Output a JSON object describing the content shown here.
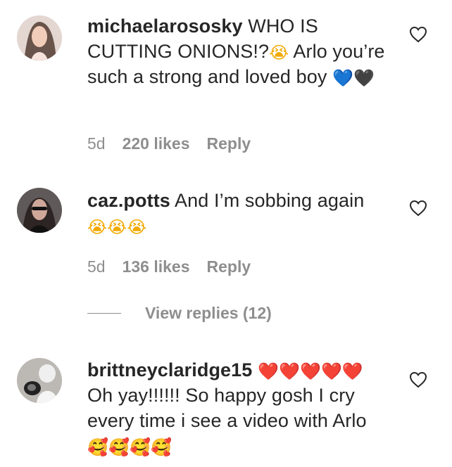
{
  "comments": [
    {
      "username": "michaelarososky",
      "text_1": "WHO IS CUTTING ONIONS!?",
      "emoji_1": "😭",
      "text_2": " Arlo you’re such a strong and loved boy ",
      "emoji_2a": "💙",
      "emoji_2b": "🖤",
      "age": "5d",
      "likes": "220 likes",
      "reply": "Reply"
    },
    {
      "username": "caz.potts",
      "text_1": "And I’m sobbing again ",
      "emoji_1": "😭😭😭",
      "age": "5d",
      "likes": "136 likes",
      "reply": "Reply",
      "view_replies": "View replies (12)"
    },
    {
      "username": "brittneyclaridge15",
      "emoji_1": "❤️❤️❤️❤️❤️",
      "text_1": "Oh yay!!!!!! So happy gosh I cry every time i see a video with Arlo ",
      "emoji_2": "🥰🥰🥰🥰"
    }
  ],
  "icons": {
    "like": "heart-outline-icon"
  },
  "colors": {
    "text": "#262626",
    "muted": "#8e8e8e",
    "blue_heart": "#1d8cf8",
    "red_heart": "#e01e2b"
  }
}
